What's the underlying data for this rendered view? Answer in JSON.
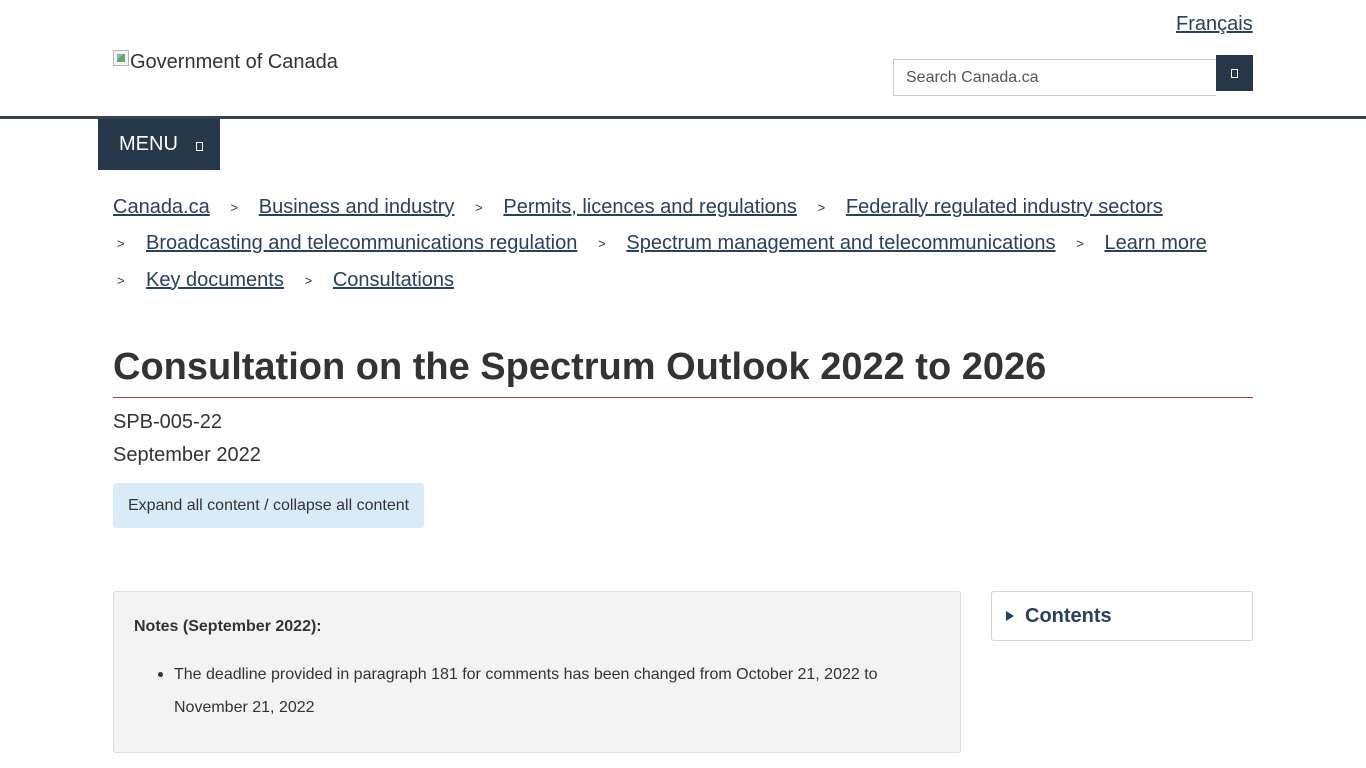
{
  "header": {
    "language_link": "Français",
    "logo_alt": "Government of Canada",
    "search": {
      "placeholder": "Search Canada.ca",
      "button_icon": "search-icon"
    },
    "menu": {
      "label": "MENU",
      "icon": "chevron-down-icon"
    }
  },
  "breadcrumb": {
    "separator": ">",
    "items": [
      "Canada.ca",
      "Business and industry",
      "Permits, licences and regulations",
      "Federally regulated industry sectors",
      "Broadcasting and telecommunications regulation",
      "Spectrum management and telecommunications",
      "Learn more",
      "Key documents",
      "Consultations"
    ]
  },
  "main": {
    "title": "Consultation on the Spectrum Outlook 2022 to 2026",
    "document_number": "SPB-005-22",
    "date": "September 2022",
    "expand_button": "Expand all content / collapse all content",
    "notes": {
      "heading": "Notes (September 2022):",
      "items": [
        "The deadline provided in paragraph 181 for comments has been changed from October 21, 2022 to November 21, 2022"
      ]
    },
    "contents_label": "Contents"
  },
  "colors": {
    "link": "#284162",
    "nav_dark": "#26374a",
    "title_rule": "#af3c43",
    "expand_bg": "#d7ecf7",
    "notes_bg": "#f3f3f3"
  }
}
